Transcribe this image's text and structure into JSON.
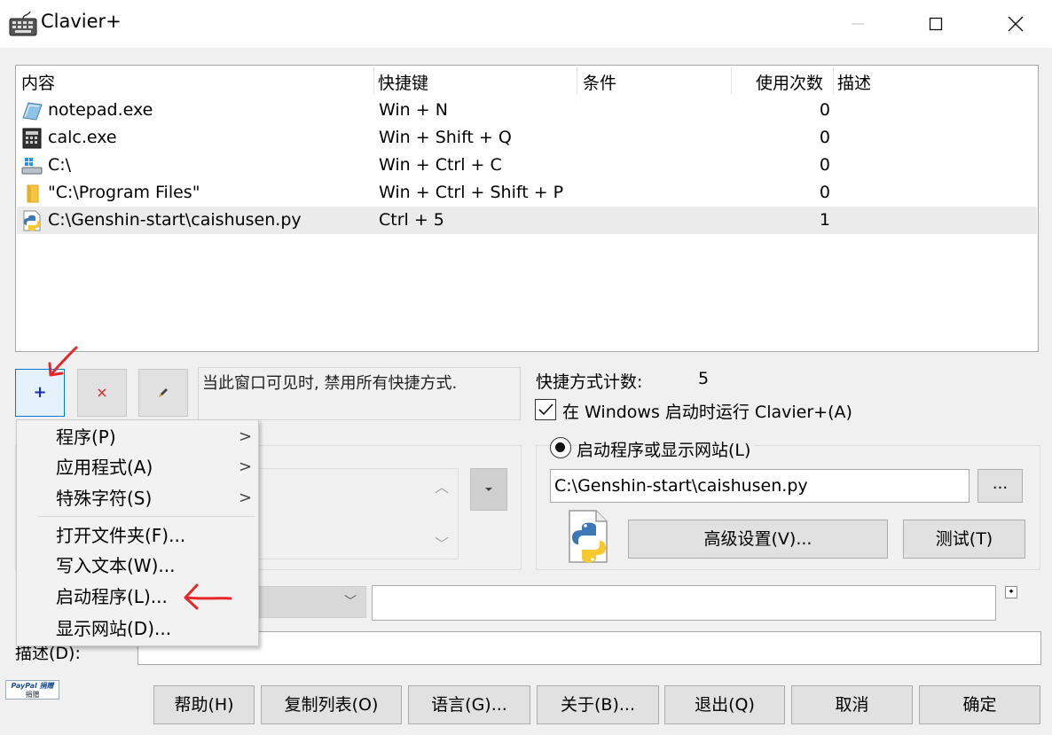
{
  "window": {
    "title": "Clavier+"
  },
  "list": {
    "columns": [
      "内容",
      "快捷键",
      "条件",
      "使用次数",
      "描述"
    ],
    "rows": [
      {
        "content": "notepad.exe",
        "shortcut": "Win + N",
        "condition": "",
        "usage": "0",
        "description": "",
        "icon": "notepad-icon"
      },
      {
        "content": "calc.exe",
        "shortcut": "Win + Shift + Q",
        "condition": "",
        "usage": "0",
        "description": "",
        "icon": "calculator-icon"
      },
      {
        "content": "C:\\",
        "shortcut": "Win + Ctrl + C",
        "condition": "",
        "usage": "0",
        "description": "",
        "icon": "drive-icon"
      },
      {
        "content": "\"C:\\Program Files\"",
        "shortcut": "Win + Ctrl + Shift + P",
        "condition": "",
        "usage": "0",
        "description": "",
        "icon": "folder-icon"
      },
      {
        "content": "C:\\Genshin-start\\caishusen.py",
        "shortcut": "Ctrl + 5",
        "condition": "",
        "usage": "1",
        "description": "",
        "icon": "python-file-icon",
        "selected": true
      }
    ]
  },
  "toolbar": {
    "add": "+",
    "delete": "×",
    "hint": "当此窗口可见时, 禁用所有快捷方式."
  },
  "status": {
    "count_label": "快捷方式计数:",
    "count_value": "5",
    "startup_label": "在 Windows 启动时运行 Clavier+(A)",
    "startup_checked": true
  },
  "launch": {
    "radio_label": "启动程序或显示网站(L)",
    "path": "C:\\Genshin-start\\caishusen.py",
    "browse": "...",
    "advanced": "高级设置(V)...",
    "test": "测试(T)"
  },
  "description": {
    "label": "描述(D):"
  },
  "paypal": {
    "line1": "PayPal 捐赠",
    "line2": "捐赠"
  },
  "bottom_buttons": [
    "帮助(H)",
    "复制列表(O)",
    "语言(G)...",
    "关于(B)...",
    "退出(Q)",
    "取消",
    "确定"
  ],
  "menu": {
    "items": [
      {
        "label": "程序(P)",
        "submenu": true
      },
      {
        "label": "应用程式(A)",
        "submenu": true
      },
      {
        "label": "特殊字符(S)",
        "submenu": true
      },
      {
        "label": "打开文件夹(F)...",
        "submenu": false
      },
      {
        "label": "写入文本(W)...",
        "submenu": false
      },
      {
        "label": "启动程序(L)...",
        "submenu": false
      },
      {
        "label": "显示网站(D)...",
        "submenu": false
      }
    ],
    "submenu_arrow": ">"
  },
  "colors": {
    "accent": "#0078d7",
    "annotation": "#e8262a",
    "selection": "#ebebeb"
  }
}
